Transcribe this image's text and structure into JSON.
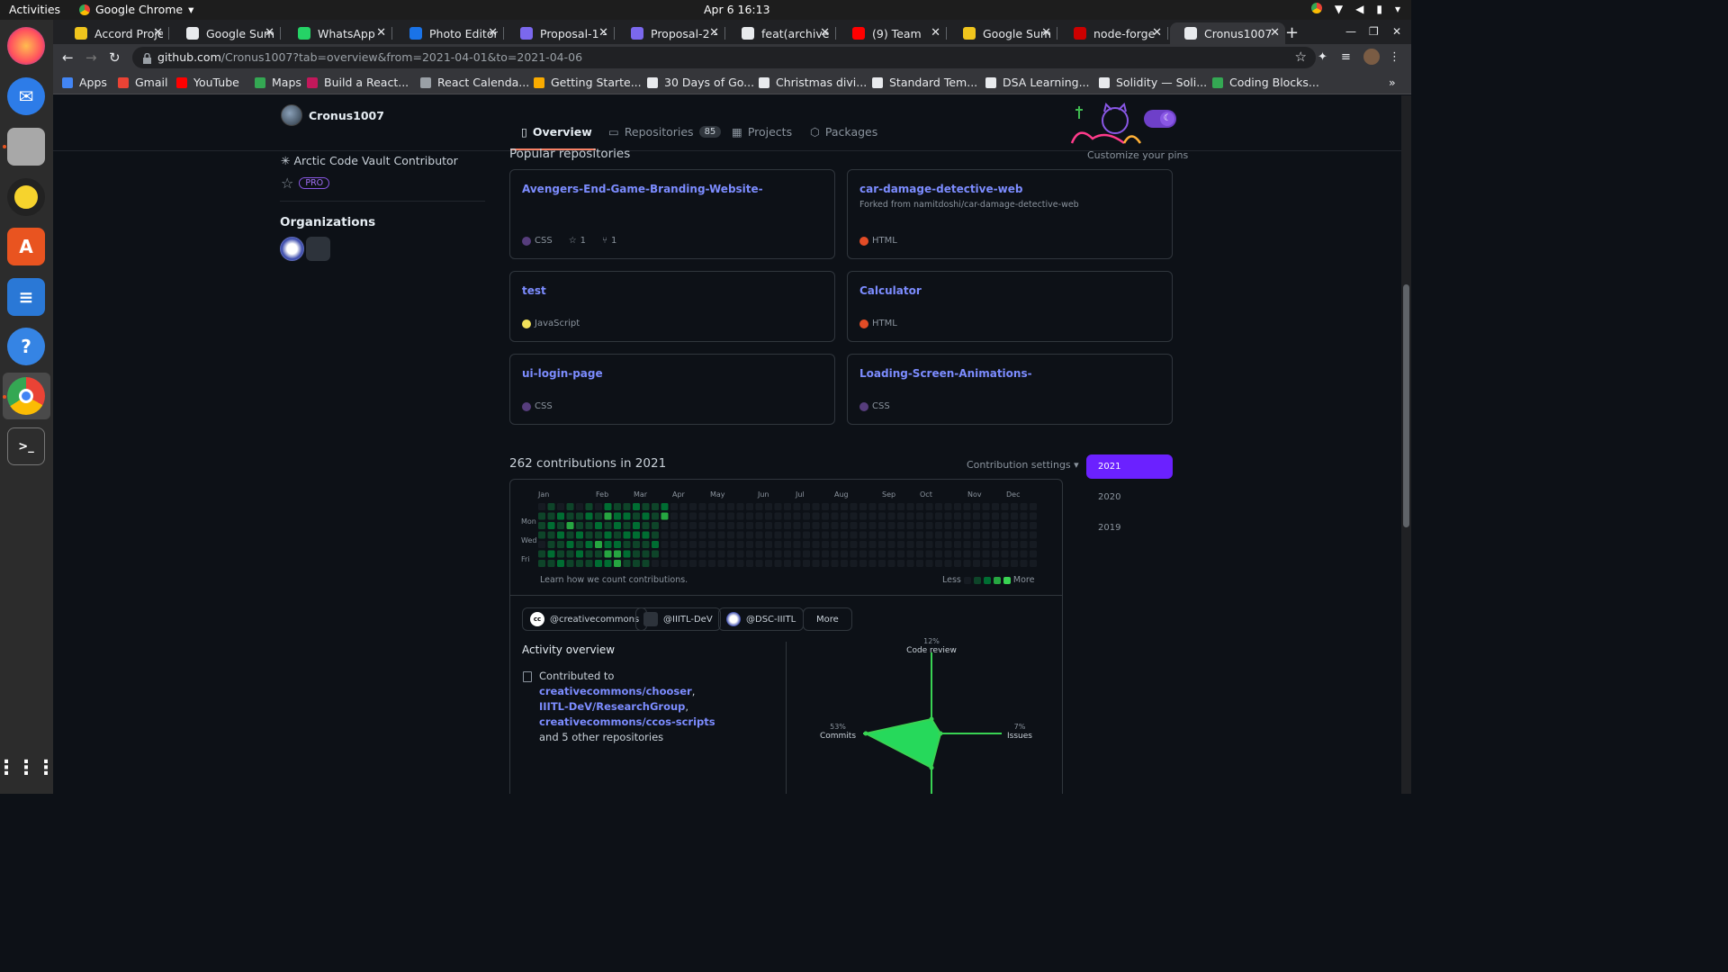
{
  "system": {
    "activities": "Activities",
    "app_menu": "Google Chrome",
    "clock": "Apr 6  16:13"
  },
  "tabs": [
    {
      "label": "Accord Proje",
      "color": "#f0c51d",
      "active": false
    },
    {
      "label": "Google Sum",
      "color": "#e8eaed",
      "active": false
    },
    {
      "label": "WhatsApp",
      "color": "#25d366",
      "active": false
    },
    {
      "label": "Photo Editor",
      "color": "#1a73e8",
      "active": false
    },
    {
      "label": "Proposal-1 -",
      "color": "#7b68ee",
      "active": false
    },
    {
      "label": "Proposal-2 -",
      "color": "#7b68ee",
      "active": false
    },
    {
      "label": "feat(archive",
      "color": "#e8eaed",
      "active": false
    },
    {
      "label": "(9) Team",
      "color": "#ff0000",
      "active": false
    },
    {
      "label": "Google Sum",
      "color": "#f0c51d",
      "active": false
    },
    {
      "label": "node-forge",
      "color": "#cc0000",
      "active": false
    },
    {
      "label": "Cronus1007",
      "color": "#e8eaed",
      "active": true
    }
  ],
  "omnibox": {
    "domain": "github.com",
    "path": "/Cronus1007?tab=overview&from=2021-04-01&to=2021-04-06"
  },
  "bookmarks": [
    {
      "label": "Apps",
      "color": "#4285f4"
    },
    {
      "label": "Gmail",
      "color": "#ea4335"
    },
    {
      "label": "YouTube",
      "color": "#ff0000"
    },
    {
      "label": "Maps",
      "color": "#34a853"
    },
    {
      "label": "Build a React...",
      "color": "#c2185b"
    },
    {
      "label": "React Calenda...",
      "color": "#9aa0a6"
    },
    {
      "label": "Getting Starte...",
      "color": "#f9ab00"
    },
    {
      "label": "30 Days of Go...",
      "color": "#e8eaed"
    },
    {
      "label": "Christmas divi...",
      "color": "#e8eaed"
    },
    {
      "label": "Standard Tem...",
      "color": "#e8eaed"
    },
    {
      "label": "DSA Learning...",
      "color": "#e8eaed"
    },
    {
      "label": "Solidity — Soli...",
      "color": "#e8eaed"
    },
    {
      "label": "Coding Blocks...",
      "color": "#34a853"
    }
  ],
  "profile": {
    "username": "Cronus1007",
    "nav": [
      {
        "label": "Overview",
        "count": ""
      },
      {
        "label": "Repositories",
        "count": "85"
      },
      {
        "label": "Projects",
        "count": ""
      },
      {
        "label": "Packages",
        "count": ""
      }
    ],
    "achievement": "Arctic Code Vault Contributor",
    "pro_badge": "PRO",
    "organizations_title": "Organizations"
  },
  "popular": {
    "title": "Popular repositories",
    "customize": "Customize your pins",
    "repos": [
      {
        "name": "Avengers-End-Game-Branding-Website-",
        "forked_from": "",
        "lang": "CSS",
        "lang_color": "#563d7c",
        "stars": "1",
        "forks": "1"
      },
      {
        "name": "car-damage-detective-web",
        "forked_from": "Forked from namitdoshi/car-damage-detective-web",
        "lang": "HTML",
        "lang_color": "#e34c26",
        "stars": "",
        "forks": ""
      },
      {
        "name": "test",
        "forked_from": "",
        "lang": "JavaScript",
        "lang_color": "#f1e05a",
        "stars": "",
        "forks": ""
      },
      {
        "name": "Calculator",
        "forked_from": "",
        "lang": "HTML",
        "lang_color": "#e34c26",
        "stars": "",
        "forks": ""
      },
      {
        "name": "ui-login-page",
        "forked_from": "",
        "lang": "CSS",
        "lang_color": "#563d7c",
        "stars": "",
        "forks": ""
      },
      {
        "name": "Loading-Screen-Animations-",
        "forked_from": "",
        "lang": "CSS",
        "lang_color": "#563d7c",
        "stars": "",
        "forks": ""
      }
    ]
  },
  "contributions": {
    "title": "262 contributions in 2021",
    "settings": "Contribution settings",
    "months": [
      "Jan",
      "Feb",
      "Mar",
      "Apr",
      "May",
      "Jun",
      "Jul",
      "Aug",
      "Sep",
      "Oct",
      "Nov",
      "Dec"
    ],
    "days": [
      "Mon",
      "Wed",
      "Fri"
    ],
    "learn": "Learn how we count contributions.",
    "less": "Less",
    "more": "More",
    "colors": [
      "#161b22",
      "#0e4429",
      "#006d32",
      "#26a641",
      "#39d353"
    ]
  },
  "orgs_filter": [
    "@creativecommons",
    "@IIITL-DeV",
    "@DSC-IIITL",
    "More"
  ],
  "activity": {
    "title": "Activity overview",
    "prefix": "Contributed to ",
    "repo1": "creativecommons/chooser",
    "repo2": "IIITL-DeV/ResearchGroup",
    "repo3": "creativecommons/ccos-scripts",
    "suffix": "and 5 other repositories",
    "radar": {
      "code_review_pct": "12%",
      "code_review": "Code review",
      "commits_pct": "53%",
      "commits": "Commits",
      "issues_pct": "7%",
      "issues": "Issues"
    }
  },
  "years": [
    "2021",
    "2020",
    "2019"
  ]
}
